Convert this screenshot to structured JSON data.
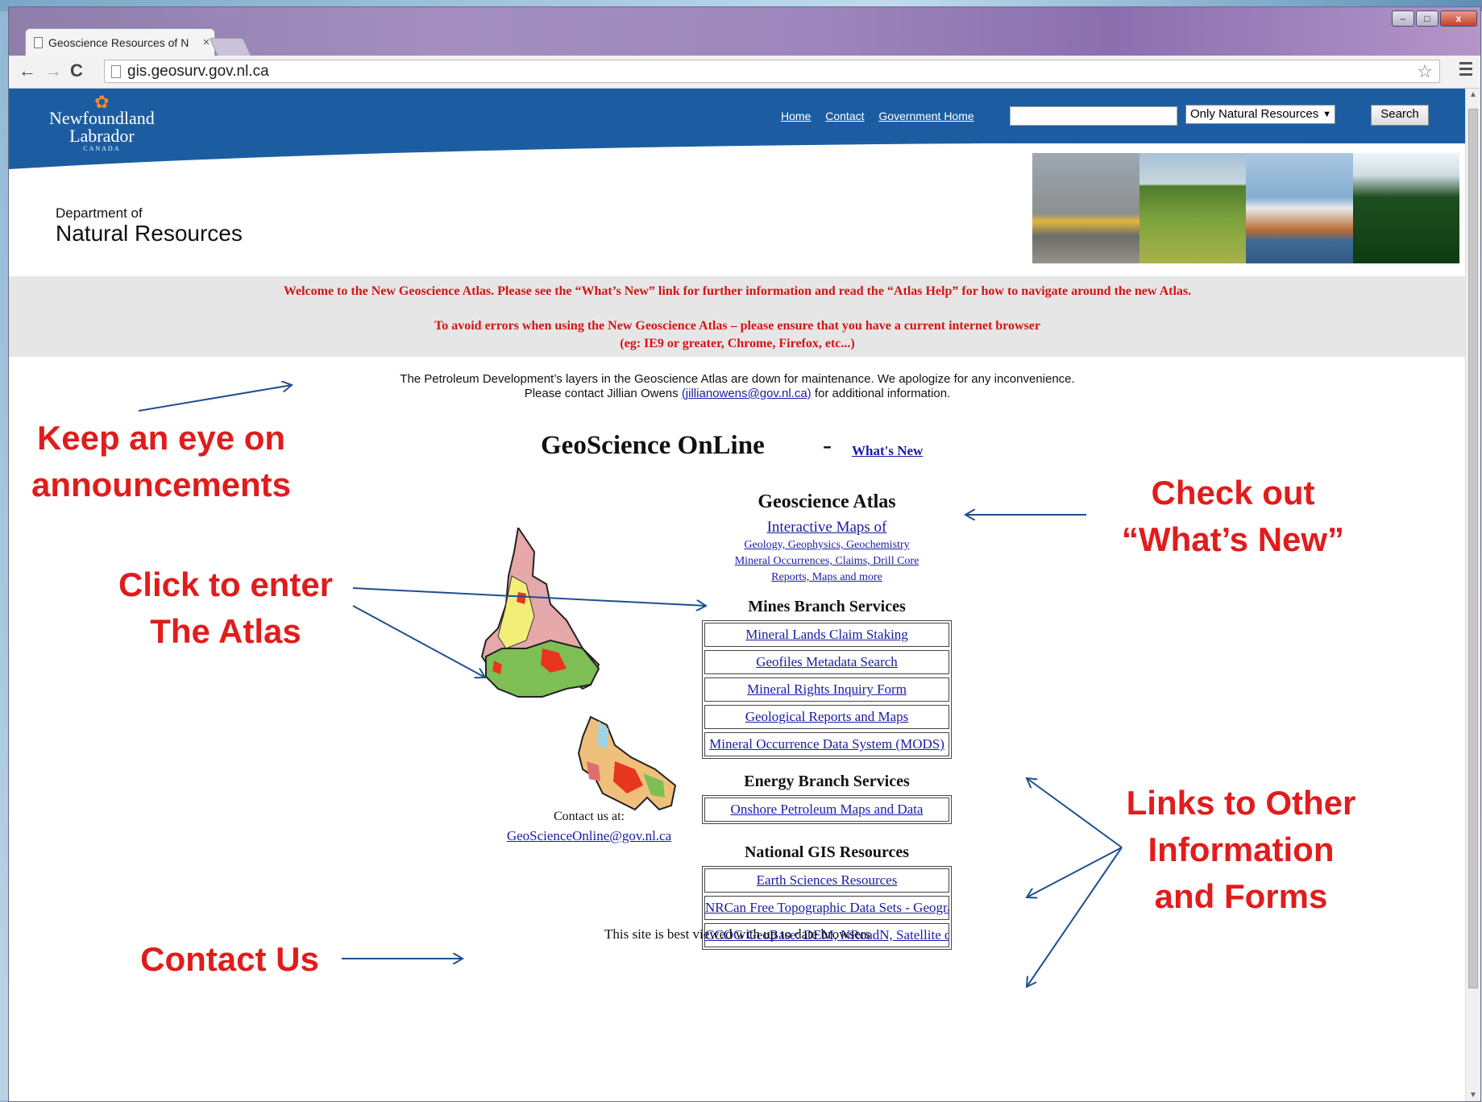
{
  "browser": {
    "tab_title": "Geoscience Resources of N",
    "tab_close": "×",
    "url": "gis.geosurv.gov.nl.ca",
    "window_controls": {
      "minimize": "–",
      "maximize": "□",
      "close": "x"
    }
  },
  "header": {
    "logo_line1": "Newfoundland",
    "logo_line2": "Labrador",
    "logo_line3": "CANADA",
    "links": [
      "Home",
      "Contact",
      "Government Home"
    ],
    "search_value": "",
    "search_scope": "Only Natural Resources",
    "search_button": "Search",
    "dept_line1": "Department of",
    "dept_line2": "Natural Resources"
  },
  "announcement": {
    "line1": "Welcome to the New Geoscience Atlas. Please see the “What’s New” link for further information and read the “Atlas Help” for how to navigate around the new Atlas.",
    "line2": "To avoid errors when using the New Geoscience Atlas – please ensure that you have a current internet browser",
    "line3": "(eg: IE9 or greater, Chrome, Firefox, etc...)"
  },
  "maintenance": {
    "line1": "The Petroleum Development’s layers in the Geoscience Atlas are down for maintenance. We apologize for any inconvenience.",
    "line2_prefix": "Please contact Jillian Owens",
    "email": "(jillianowens@gov.nl.ca)",
    "line2_suffix": "for additional information."
  },
  "main": {
    "title": "GeoScience OnLine",
    "dash": "-",
    "whats_new": "What's New",
    "atlas": {
      "heading": "Geoscience Atlas",
      "link": "Interactive Maps of",
      "sub1": "Geology, Geophysics, Geochemistry",
      "sub2": "Mineral Occurrences, Claims, Drill Core",
      "sub3": "Reports, Maps and more"
    },
    "mines": {
      "heading": "Mines Branch Services",
      "links": [
        "Mineral Lands Claim Staking",
        "Geofiles Metadata Search",
        "Mineral Rights Inquiry Form",
        "Geological Reports and Maps",
        "Mineral Occurrence Data System (MODS)"
      ]
    },
    "energy": {
      "heading": "Energy Branch Services",
      "links": [
        "Onshore Petroleum Maps and Data"
      ]
    },
    "gis": {
      "heading": "National GIS Resources",
      "links": [
        "Earth Sciences Resources",
        "NRCan Free Topographic Data Sets - Geogratis",
        "CCOG GeoBase: DEM, NRoadN, Satellite data"
      ]
    },
    "contact_label": "Contact us at:",
    "contact_email": "GeoScienceOnline@gov.nl.ca",
    "footer": "This site is best viewed with up to date browsers"
  },
  "callouts": {
    "announcements_l1": "Keep an eye on",
    "announcements_l2": "announcements",
    "whats_new_l1": "Check out",
    "whats_new_l2": "“What’s New”",
    "atlas_l1": "Click to enter",
    "atlas_l2": "The Atlas",
    "contact": "Contact Us",
    "links_l1": "Links to Other",
    "links_l2": "Information",
    "links_l3": "and Forms"
  },
  "colors": {
    "header_blue": "#1c5da2",
    "announcement_red": "#d21414",
    "callout_red": "#e01c1c",
    "link_blue": "#1a1aa6",
    "arrow_blue": "#1f4f8f"
  }
}
